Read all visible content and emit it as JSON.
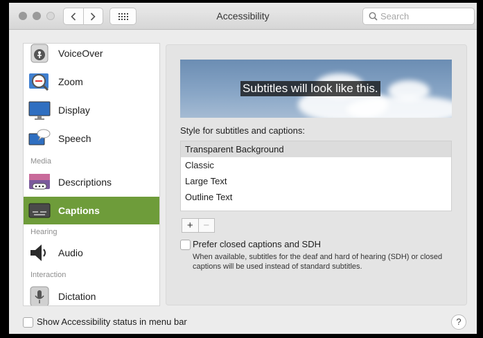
{
  "window": {
    "title": "Accessibility",
    "search_placeholder": "Search"
  },
  "sidebar": {
    "items": [
      {
        "label": "VoiceOver",
        "icon": "voiceover-icon"
      },
      {
        "label": "Zoom",
        "icon": "zoom-icon"
      },
      {
        "label": "Display",
        "icon": "display-icon"
      },
      {
        "label": "Speech",
        "icon": "speech-icon"
      },
      {
        "label": "Descriptions",
        "icon": "descriptions-icon"
      },
      {
        "label": "Captions",
        "icon": "captions-icon",
        "selected": true
      },
      {
        "label": "Audio",
        "icon": "audio-icon"
      },
      {
        "label": "Dictation",
        "icon": "dictation-icon"
      }
    ],
    "sections": {
      "media": "Media",
      "hearing": "Hearing",
      "interaction": "Interaction"
    },
    "selected_color": "#6e9c3a"
  },
  "captions": {
    "preview_text": "Subtitles will look like this.",
    "style_label": "Style for subtitles and captions:",
    "styles": [
      "Transparent Background",
      "Classic",
      "Large Text",
      "Outline Text"
    ],
    "selected_style": "Transparent Background",
    "add_label": "+",
    "remove_label": "−",
    "prefer_label": "Prefer closed captions and SDH",
    "prefer_checked": false,
    "prefer_description": "When available, subtitles for the deaf and hard of hearing (SDH) or closed captions will be used instead of standard subtitles."
  },
  "footer": {
    "status_label": "Show Accessibility status in menu bar",
    "status_checked": false,
    "help_label": "?"
  }
}
